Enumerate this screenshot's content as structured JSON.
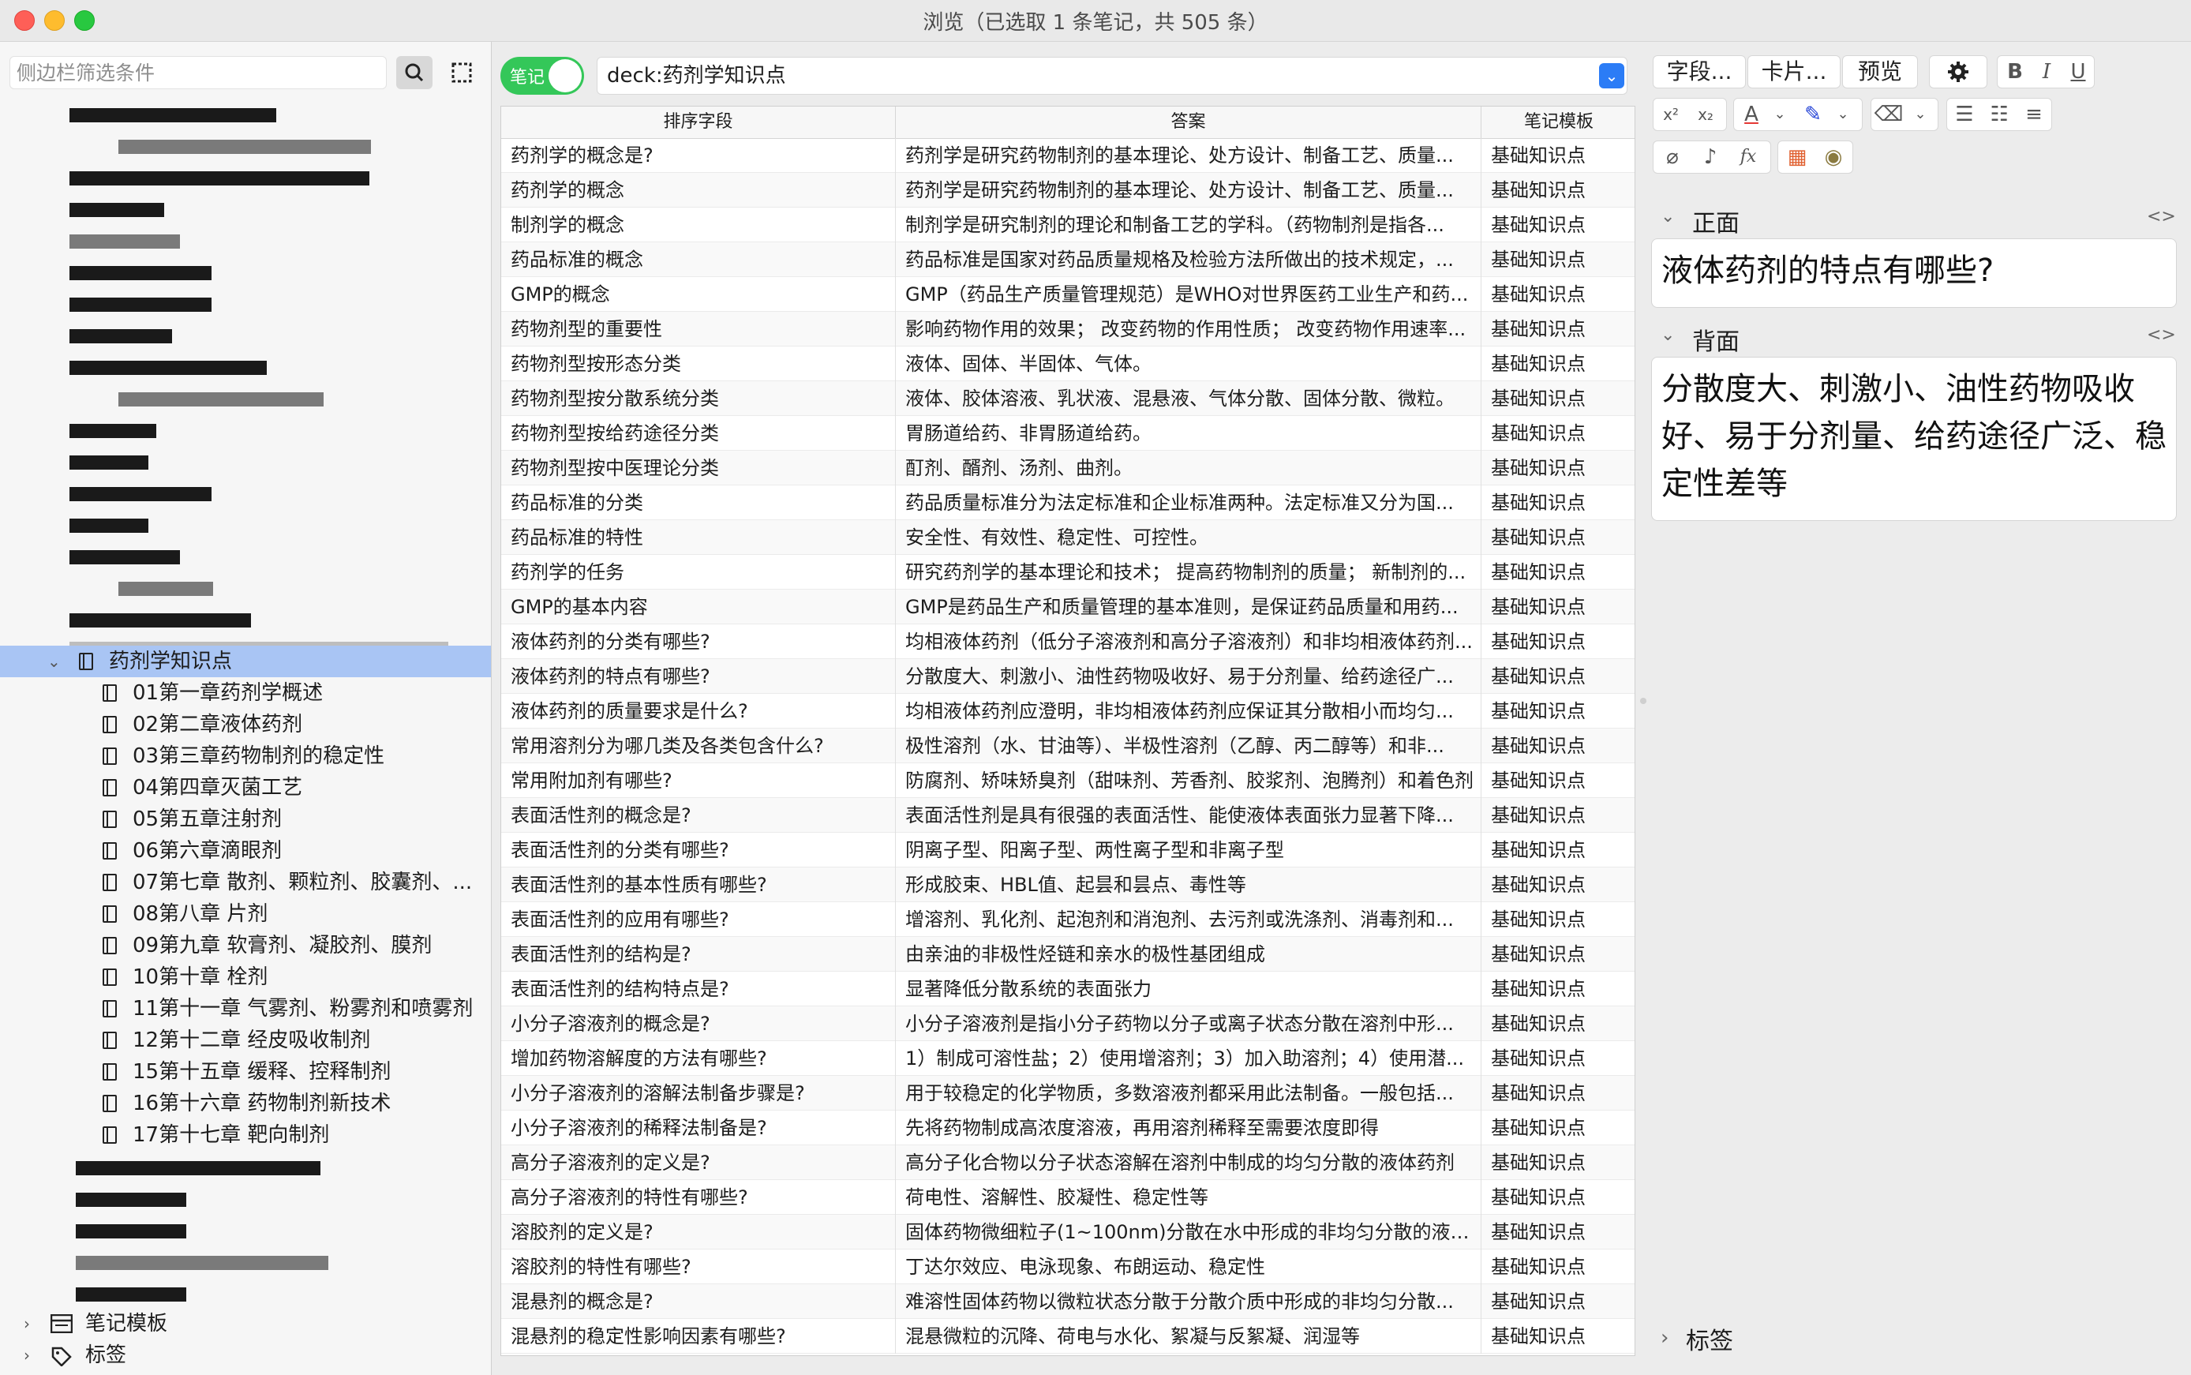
{
  "window": {
    "title": "浏览（已选取 1 条笔记，共 505 条）"
  },
  "sidebar": {
    "search_placeholder": "侧边栏筛选条件",
    "selected_deck": "药剂学知识点",
    "child_decks": [
      "01第一章药剂学概述",
      "02第二章液体药剂",
      "03第三章药物制剂的稳定性",
      "04第四章灭菌工艺",
      "05第五章注射剂",
      "06第六章滴眼剂",
      "07第七章 散剂、颗粒剂、胶囊剂、...",
      "08第八章 片剂",
      "09第九章 软膏剂、凝胶剂、膜剂",
      "10第十章 栓剂",
      "11第十一章 气雾剂、粉雾剂和喷雾剂",
      "12第十二章 经皮吸收制剂",
      "15第十五章 缓释、控释制剂",
      "16第十六章 药物制剂新技术",
      "17第十七章 靶向制剂"
    ],
    "note_types_label": "笔记模板",
    "tags_label": "标签"
  },
  "toolbar": {
    "toggle_label": "笔记",
    "query": "deck:药剂学知识点"
  },
  "table": {
    "columns": [
      "排序字段",
      "答案",
      "笔记模板"
    ],
    "rows": [
      [
        "药剂学的概念是?",
        "药剂学是研究药物制剂的基本理论、处方设计、制备工艺、质量...",
        "基础知识点"
      ],
      [
        "药剂学的概念",
        "药剂学是研究药物制剂的基本理论、处方设计、制备工艺、质量...",
        "基础知识点"
      ],
      [
        "制剂学的概念",
        "制剂学是研究制剂的理论和制备工艺的学科。（药物制剂是指各...",
        "基础知识点"
      ],
      [
        "药品标准的概念",
        "药品标准是国家对药品质量规格及检验方法所做出的技术规定，...",
        "基础知识点"
      ],
      [
        "GMP的概念",
        "GMP（药品生产质量管理规范）是WHO对世界医药工业生产和药...",
        "基础知识点"
      ],
      [
        "药物剂型的重要性",
        "影响药物作用的效果； 改变药物的作用性质； 改变药物作用速率...",
        "基础知识点"
      ],
      [
        "药物剂型按形态分类",
        "液体、固体、半固体、气体。",
        "基础知识点"
      ],
      [
        "药物剂型按分散系统分类",
        "液体、胶体溶液、乳状液、混悬液、气体分散、固体分散、微粒。",
        "基础知识点"
      ],
      [
        "药物剂型按给药途径分类",
        "胃肠道给药、非胃肠道给药。",
        "基础知识点"
      ],
      [
        "药物剂型按中医理论分类",
        "酊剂、醑剂、汤剂、曲剂。",
        "基础知识点"
      ],
      [
        "药品标准的分类",
        "药品质量标准分为法定标准和企业标准两种。法定标准又分为国...",
        "基础知识点"
      ],
      [
        "药品标准的特性",
        "安全性、有效性、稳定性、可控性。",
        "基础知识点"
      ],
      [
        "药剂学的任务",
        "研究药剂学的基本理论和技术； 提高药物制剂的质量； 新制剂的...",
        "基础知识点"
      ],
      [
        "GMP的基本内容",
        "GMP是药品生产和质量管理的基本准则，是保证药品质量和用药...",
        "基础知识点"
      ],
      [
        "液体药剂的分类有哪些?",
        "均相液体药剂（低分子溶液剂和高分子溶液剂）和非均相液体药剂...",
        "基础知识点"
      ],
      [
        "液体药剂的特点有哪些?",
        "分散度大、刺激小、油性药物吸收好、易于分剂量、给药途径广...",
        "基础知识点"
      ],
      [
        "液体药剂的质量要求是什么?",
        "均相液体药剂应澄明，非均相液体药剂应保证其分散相小而均匀...",
        "基础知识点"
      ],
      [
        "常用溶剂分为哪几类及各类包含什么?",
        "极性溶剂（水、甘油等）、半极性溶剂（乙醇、丙二醇等）和非...",
        "基础知识点"
      ],
      [
        "常用附加剂有哪些?",
        "防腐剂、矫味矫臭剂（甜味剂、芳香剂、胶浆剂、泡腾剂）和着色剂",
        "基础知识点"
      ],
      [
        "表面活性剂的概念是?",
        "表面活性剂是具有很强的表面活性、能使液体表面张力显著下降...",
        "基础知识点"
      ],
      [
        "表面活性剂的分类有哪些?",
        "阴离子型、阳离子型、两性离子型和非离子型",
        "基础知识点"
      ],
      [
        "表面活性剂的基本性质有哪些?",
        "形成胶束、HBL值、起昙和昙点、毒性等",
        "基础知识点"
      ],
      [
        "表面活性剂的应用有哪些?",
        "增溶剂、乳化剂、起泡剂和消泡剂、去污剂或洗涤剂、消毒剂和...",
        "基础知识点"
      ],
      [
        "表面活性剂的结构是?",
        "由亲油的非极性烃链和亲水的极性基团组成",
        "基础知识点"
      ],
      [
        "表面活性剂的结构特点是?",
        "显著降低分散系统的表面张力",
        "基础知识点"
      ],
      [
        "小分子溶液剂的概念是?",
        "小分子溶液剂是指小分子药物以分子或离子状态分散在溶剂中形...",
        "基础知识点"
      ],
      [
        "增加药物溶解度的方法有哪些?",
        "1）制成可溶性盐；2）使用增溶剂；3）加入助溶剂；4）使用潜...",
        "基础知识点"
      ],
      [
        "小分子溶液剂的溶解法制备步骤是?",
        "用于较稳定的化学物质，多数溶液剂都采用此法制备。一般包括...",
        "基础知识点"
      ],
      [
        "小分子溶液剂的稀释法制备是?",
        "先将药物制成高浓度溶液，再用溶剂稀释至需要浓度即得",
        "基础知识点"
      ],
      [
        "高分子溶液剂的定义是?",
        "高分子化合物以分子状态溶解在溶剂中制成的均匀分散的液体药剂",
        "基础知识点"
      ],
      [
        "高分子溶液剂的特性有哪些?",
        "荷电性、溶解性、胶凝性、稳定性等",
        "基础知识点"
      ],
      [
        "溶胶剂的定义是?",
        "固体药物微细粒子(1~100nm)分散在水中形成的非均匀分散的液体...",
        "基础知识点"
      ],
      [
        "溶胶剂的特性有哪些?",
        "丁达尔效应、电泳现象、布朗运动、稳定性",
        "基础知识点"
      ],
      [
        "混悬剂的概念是?",
        "难溶性固体药物以微粒状态分散于分散介质中形成的非均匀分散...",
        "基础知识点"
      ],
      [
        "混悬剂的稳定性影响因素有哪些?",
        "混悬微粒的沉降、荷电与水化、絮凝与反絮凝、润湿等",
        "基础知识点"
      ]
    ]
  },
  "editor": {
    "fields_button": "字段...",
    "cards_button": "卡片...",
    "preview_button": "预览",
    "front_label": "正面",
    "front_value": "液体药剂的特点有哪些?",
    "back_label": "背面",
    "back_value": "分散度大、刺激小、油性药物吸收好、易于分剂量、给药途径广泛、稳定性差等",
    "tags_label": "标签"
  }
}
